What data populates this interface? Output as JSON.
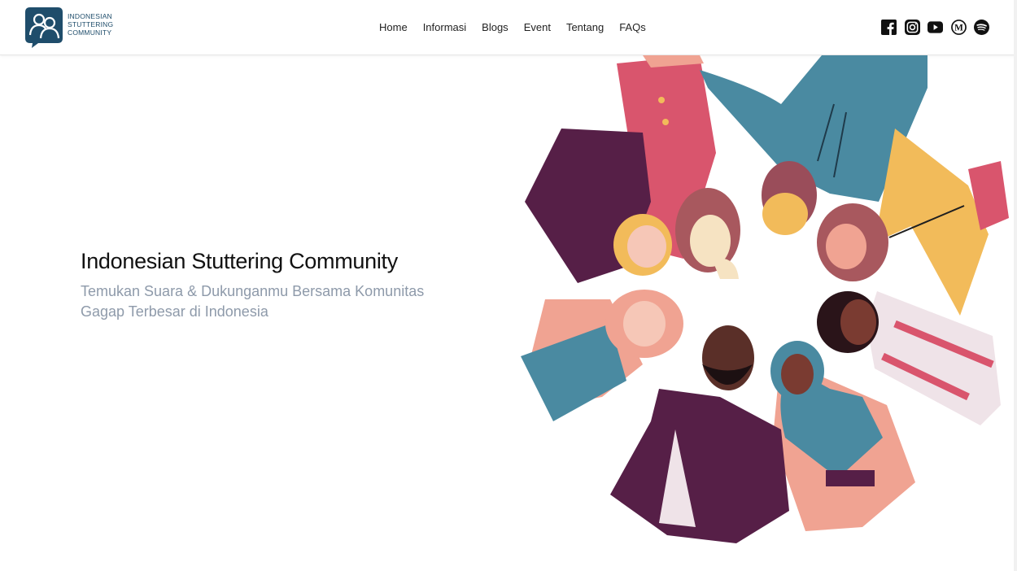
{
  "brand": {
    "logo_line1": "INDONESIAN",
    "logo_line2": "STUTTERING",
    "logo_line3": "COMMUNITY",
    "color": "#1f4d6b"
  },
  "nav": {
    "items": [
      {
        "label": "Home"
      },
      {
        "label": "Informasi"
      },
      {
        "label": "Blogs"
      },
      {
        "label": "Event"
      },
      {
        "label": "Tentang"
      },
      {
        "label": "FAQs"
      }
    ]
  },
  "socials": [
    "facebook-icon",
    "instagram-icon",
    "youtube-icon",
    "medium-icon",
    "spotify-icon"
  ],
  "hero": {
    "title": "Indonesian Stuttering Community",
    "subtitle": "Temukan Suara & Dukunganmu Bersama Komunitas Gagap Terbesar di Indonesia",
    "illustration": "diverse-people-circle-illustration"
  },
  "colors": {
    "plum": "#561f47",
    "teal": "#4a8aa1",
    "coral": "#d9556d",
    "mustard": "#f2bb5a",
    "peach": "#f0a392",
    "subtitle": "#8e9aaa"
  }
}
